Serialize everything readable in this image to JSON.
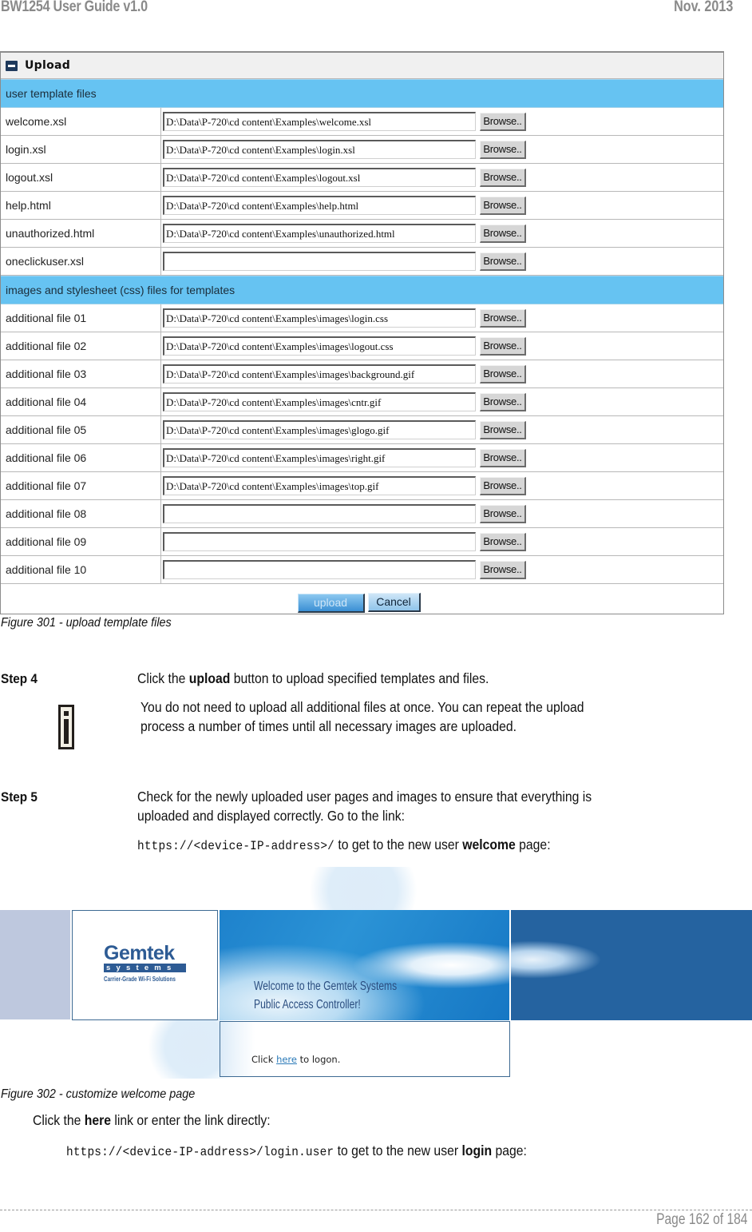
{
  "header": {
    "doc_title": "BW1254 User Guide v1.0",
    "date": "Nov.  2013"
  },
  "upload_panel": {
    "title": "Upload",
    "title_icon": "arrow-right-box-icon",
    "sections": [
      {
        "title": "user template files",
        "rows": [
          {
            "label": "welcome.xsl",
            "value": "D:\\Data\\P-720\\cd content\\Examples\\welcome.xsl",
            "button": "Browse.."
          },
          {
            "label": "login.xsl",
            "value": "D:\\Data\\P-720\\cd content\\Examples\\login.xsl",
            "button": "Browse.."
          },
          {
            "label": "logout.xsl",
            "value": "D:\\Data\\P-720\\cd content\\Examples\\logout.xsl",
            "button": "Browse.."
          },
          {
            "label": "help.html",
            "value": "D:\\Data\\P-720\\cd content\\Examples\\help.html",
            "button": "Browse.."
          },
          {
            "label": "unauthorized.html",
            "value": "D:\\Data\\P-720\\cd content\\Examples\\unauthorized.html",
            "button": "Browse.."
          },
          {
            "label": "oneclickuser.xsl",
            "value": "",
            "button": "Browse.."
          }
        ]
      },
      {
        "title": "images and stylesheet (css) files for templates",
        "rows": [
          {
            "label": "additional file 01",
            "value": "D:\\Data\\P-720\\cd content\\Examples\\images\\login.css",
            "button": "Browse.."
          },
          {
            "label": "additional file 02",
            "value": "D:\\Data\\P-720\\cd content\\Examples\\images\\logout.css",
            "button": "Browse.."
          },
          {
            "label": "additional file 03",
            "value": "D:\\Data\\P-720\\cd content\\Examples\\images\\background.gif",
            "button": "Browse.."
          },
          {
            "label": "additional file 04",
            "value": "D:\\Data\\P-720\\cd content\\Examples\\images\\cntr.gif",
            "button": "Browse.."
          },
          {
            "label": "additional file 05",
            "value": "D:\\Data\\P-720\\cd content\\Examples\\images\\glogo.gif",
            "button": "Browse.."
          },
          {
            "label": "additional file 06",
            "value": "D:\\Data\\P-720\\cd content\\Examples\\images\\right.gif",
            "button": "Browse.."
          },
          {
            "label": "additional file 07",
            "value": "D:\\Data\\P-720\\cd content\\Examples\\images\\top.gif",
            "button": "Browse.."
          },
          {
            "label": "additional file 08",
            "value": "",
            "button": "Browse.."
          },
          {
            "label": "additional file 09",
            "value": "",
            "button": "Browse.."
          },
          {
            "label": "additional file 10",
            "value": "",
            "button": "Browse.."
          }
        ]
      }
    ],
    "upload_button": "upload",
    "cancel_button": "Cancel",
    "colors": {
      "section_bg": "#66c3f2",
      "title_bg": "#f0f0f0"
    }
  },
  "figure301_caption": "Figure 301 - upload template files",
  "step4": {
    "label": "Step 4",
    "text_before": "Click the ",
    "text_bold": "upload",
    "text_after": " button to upload specified templates and files.",
    "note_icon": "info-icon",
    "note_line1": "You do not need to upload all additional files at once. You can repeat the upload",
    "note_line2": "process a number of times until all necessary images are uploaded."
  },
  "step5": {
    "label": "Step 5",
    "line1": "Check for the newly uploaded user pages and images to ensure that everything is",
    "line2": "uploaded and displayed correctly. Go to the link:",
    "link_code": "https://<device-IP-address>/",
    "link_after": " to get to the new user ",
    "link_bold": "welcome",
    "link_end": " page:"
  },
  "welcome_page": {
    "logo_word": "Gemtek",
    "logo_bar": "systems",
    "logo_tagline": "Carrier-Grade Wi-Fi Solutions",
    "welcome_line1": "Welcome to the Gemtek Systems",
    "welcome_line2": "Public Access Controller!",
    "login_before": "Click ",
    "login_link": "here",
    "login_after": " to logon."
  },
  "figure302_caption": "Figure 302 - customize welcome page",
  "after_fig": {
    "line_before": "Click the ",
    "line_bold": "here",
    "line_after": " link or enter the link directly:",
    "code": "https://<device-IP-address>/login.user",
    "code_after": " to get to the new user ",
    "code_bold": "login",
    "code_end": " page:"
  },
  "footer": {
    "page": "Page 162 of 184"
  }
}
